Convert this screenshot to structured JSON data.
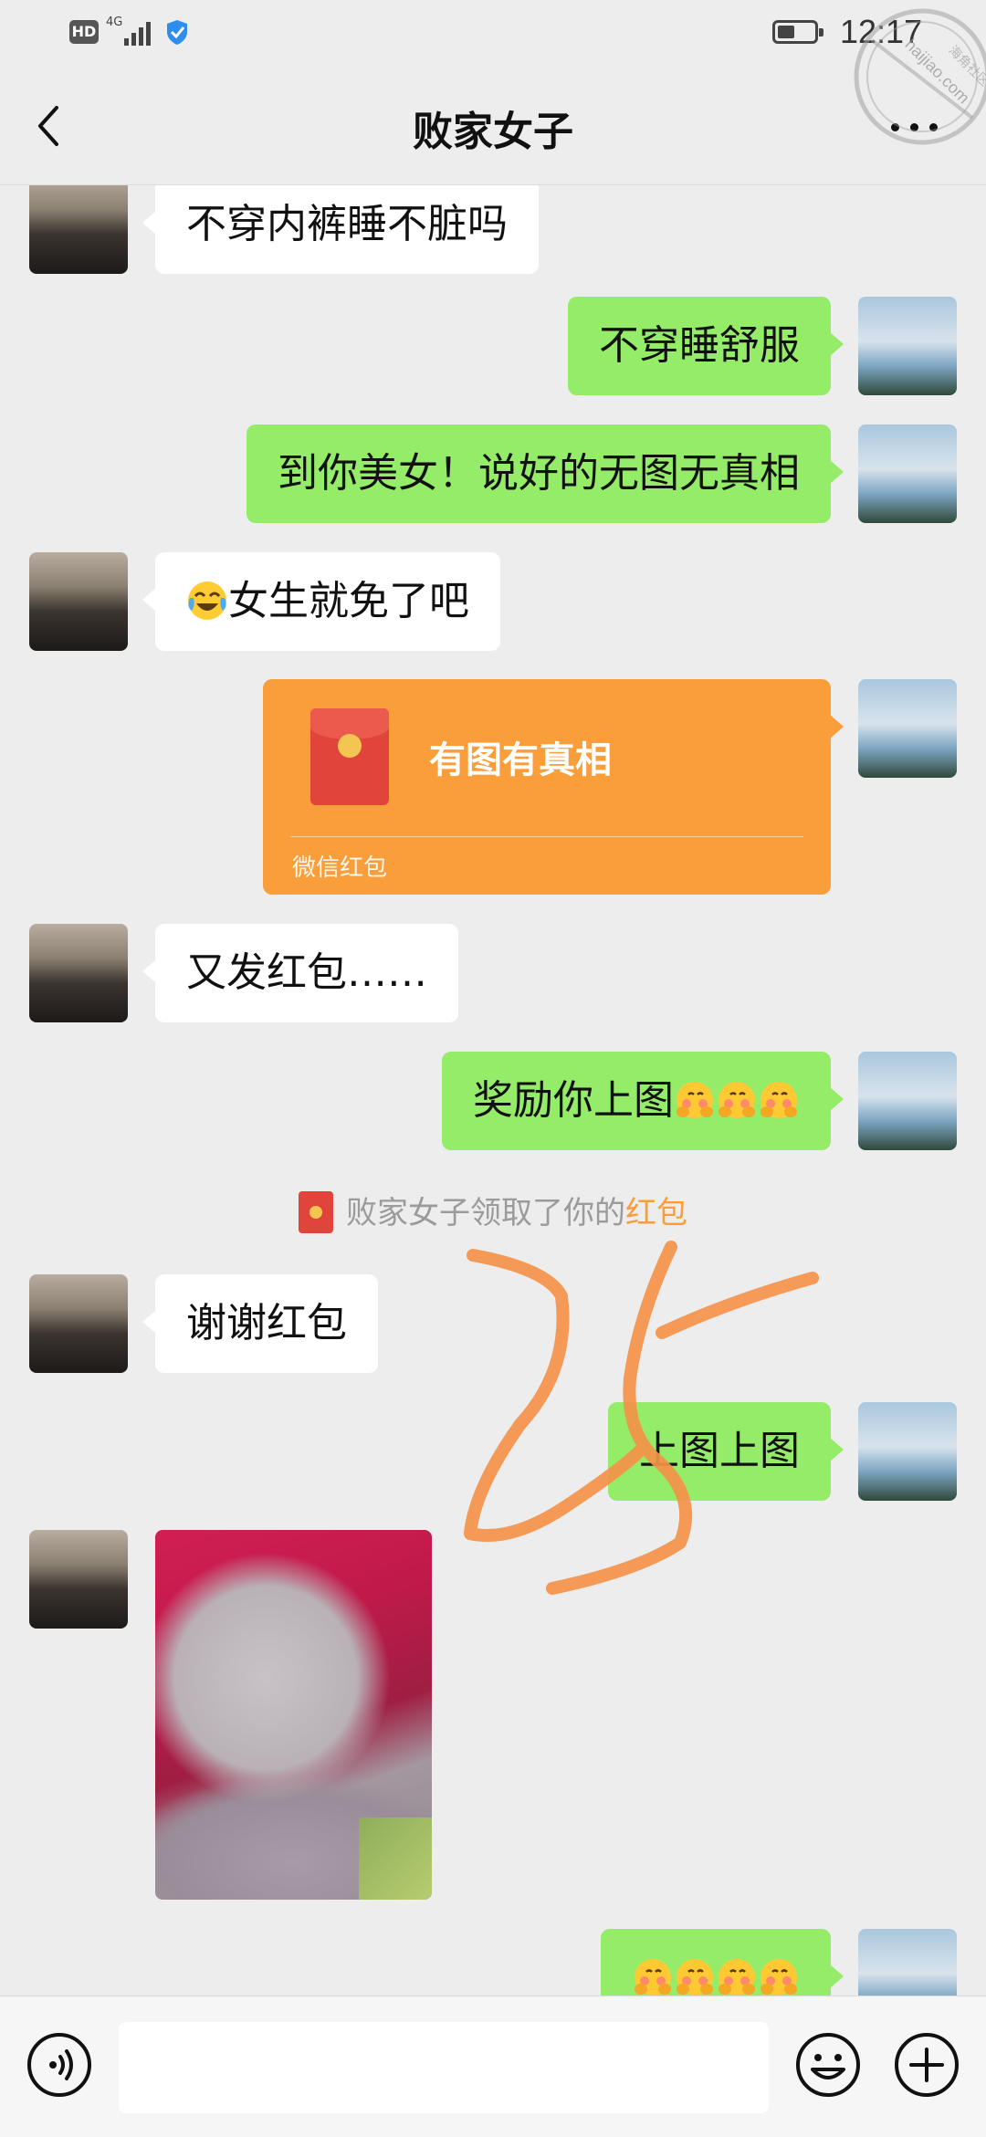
{
  "status_bar": {
    "hd": "HD",
    "network": "4G",
    "time": "12:17"
  },
  "header": {
    "title": "败家女子"
  },
  "messages": [
    {
      "from": "contact",
      "text": "不穿内裤睡不脏吗"
    },
    {
      "from": "me",
      "text": "不穿睡舒服"
    },
    {
      "from": "me",
      "text": "到你美女！说好的无图无真相"
    },
    {
      "from": "contact",
      "emoji": "tears-of-joy",
      "text": "女生就免了吧"
    },
    {
      "from": "me",
      "type": "red_packet",
      "title": "有图有真相",
      "footer": "微信红包"
    },
    {
      "from": "contact",
      "text": "又发红包……"
    },
    {
      "from": "me",
      "text": "奖励你上图",
      "emoji_suffix": [
        "shy-hiding",
        "shy-hiding",
        "shy-hiding"
      ]
    },
    {
      "from": "system",
      "text": "败家女子领取了你的",
      "link": "红包"
    },
    {
      "from": "contact",
      "text": "谢谢红包"
    },
    {
      "from": "me",
      "text": "上图上图"
    },
    {
      "from": "contact",
      "type": "image"
    },
    {
      "from": "me",
      "emoji_only": [
        "shy-hiding",
        "shy-hiding",
        "shy-hiding",
        "shy-hiding"
      ]
    }
  ],
  "input": {
    "placeholder": ""
  },
  "watermark": {
    "site": "haijiao.com",
    "text": "海角社区"
  },
  "colors": {
    "bubble_out": "#95ec69",
    "bubble_in": "#ffffff",
    "red_packet": "#fa9d3b",
    "system_link": "#fa9d3b",
    "scribble": "#f5924a"
  }
}
